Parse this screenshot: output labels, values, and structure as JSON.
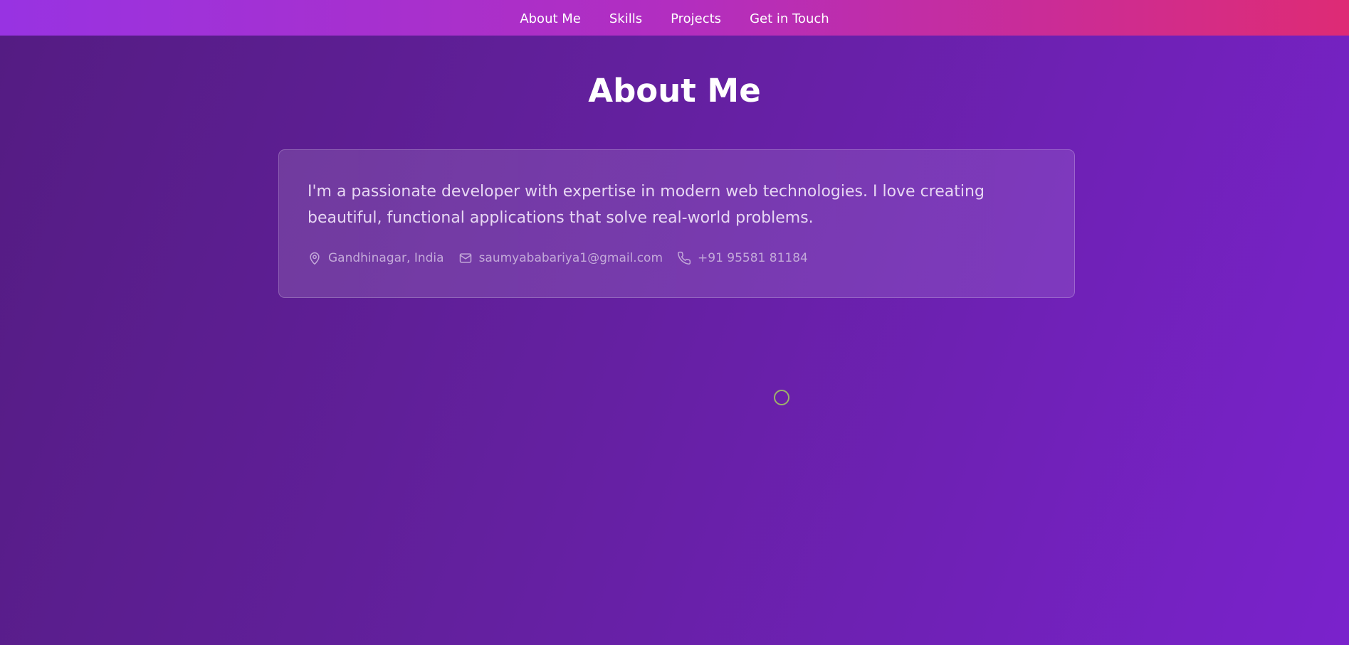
{
  "nav": {
    "items": [
      {
        "label": "About Me"
      },
      {
        "label": "Skills"
      },
      {
        "label": "Projects"
      },
      {
        "label": "Get in Touch"
      }
    ]
  },
  "about": {
    "title": "About Me",
    "bio": "I'm a passionate developer with expertise in modern web technologies. I love creating beautiful, functional applications that solve real-world problems.",
    "contacts": {
      "location": "Gandhinagar, India",
      "email": "saumyababariya1@gmail.com",
      "phone": "+91 95581 81184"
    }
  },
  "icons": {
    "location": "map-pin-icon",
    "email": "mail-icon",
    "phone": "phone-icon"
  },
  "colors": {
    "nav_gradient_start": "#9833e2",
    "nav_gradient_end": "#de2b75",
    "background": "#6420a0",
    "cursor_ring": "#9eb26a"
  }
}
